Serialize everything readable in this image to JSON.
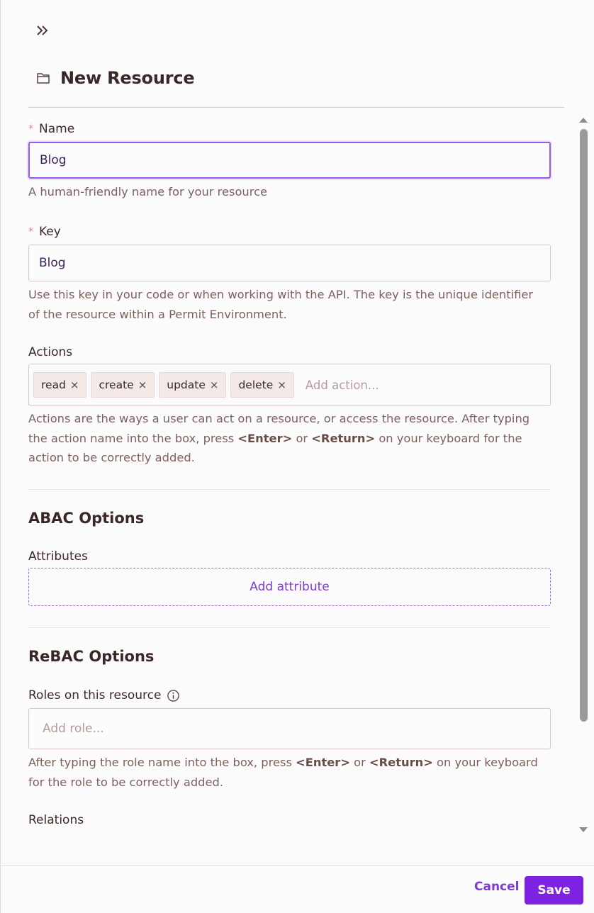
{
  "header": {
    "title": "New Resource",
    "title_icon": "folder-icon",
    "collapse_icon": "double-chevron-right-icon"
  },
  "name_field": {
    "label": "Name",
    "required_marker": "*",
    "value": "Blog",
    "helper": "A human-friendly name for your resource"
  },
  "key_field": {
    "label": "Key",
    "required_marker": "*",
    "value": "Blog",
    "helper_line1": "Use this key in your code or when working with the API. The key is the unique identifier",
    "helper_line2": "of the resource within a Permit Environment."
  },
  "actions_field": {
    "label": "Actions",
    "tags": [
      {
        "label": "read"
      },
      {
        "label": "create"
      },
      {
        "label": "update"
      },
      {
        "label": "delete"
      }
    ],
    "remove_glyph": "×",
    "placeholder": "Add action...",
    "helper_line1": "Actions are the ways a user can act on a resource, or access the resource. After typing",
    "helper_line2_a": "the action name into the box, press ",
    "helper_enter": "<Enter>",
    "helper_or": " or ",
    "helper_return": "<Return>",
    "helper_line2_b": " on your keyboard for the",
    "helper_line3": "action to be correctly added."
  },
  "abac": {
    "title": "ABAC Options",
    "attributes_label": "Attributes",
    "add_attribute": "Add attribute"
  },
  "rebac": {
    "title": "ReBAC Options",
    "roles_label": "Roles on this resource",
    "roles_info_icon": "info-icon",
    "roles_placeholder": "Add role...",
    "helper_line1_a": "After typing the role name into the box, press ",
    "helper_enter": "<Enter>",
    "helper_or": " or ",
    "helper_return": "<Return>",
    "helper_line1_b": " on your keyboard",
    "helper_line2": "for the role to be correctly added.",
    "relations_label": "Relations"
  },
  "footer": {
    "cancel": "Cancel",
    "save": "Save"
  },
  "colors": {
    "accent": "#7c22e0",
    "focus_border": "#9a5de0",
    "text": "#3a2826",
    "helper_text": "#7d615c",
    "required": "#e08080"
  }
}
